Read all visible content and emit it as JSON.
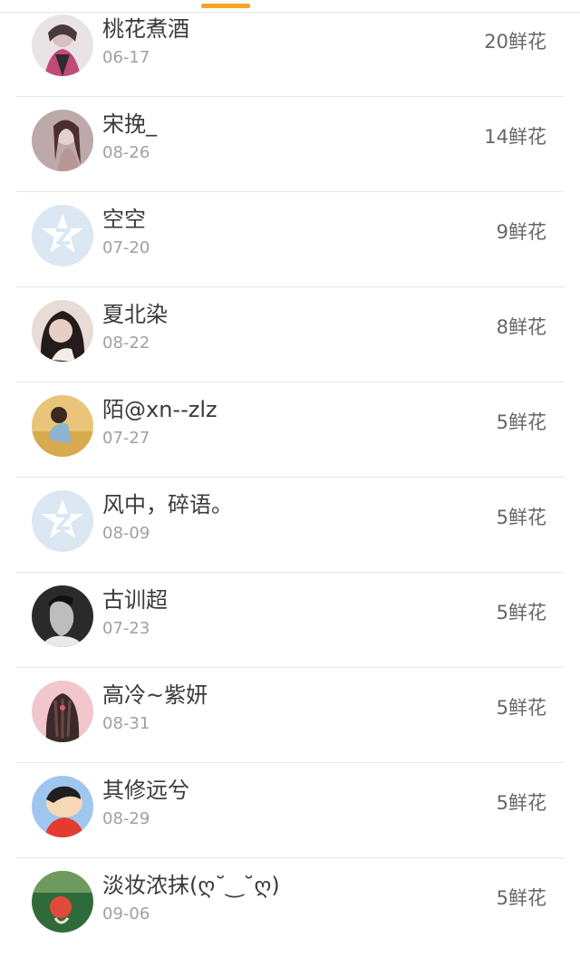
{
  "tab_indicator_color": "#f5a623",
  "rows": [
    {
      "name": "桃花煮酒",
      "date": "06-17",
      "flowers": "20鲜花",
      "avatar": "user-avatar"
    },
    {
      "name": "宋挽_",
      "date": "08-26",
      "flowers": "14鲜花",
      "avatar": "user-avatar"
    },
    {
      "name": "空空",
      "date": "07-20",
      "flowers": "9鲜花",
      "avatar": "default-avatar-icon"
    },
    {
      "name": "夏北染",
      "date": "08-22",
      "flowers": "8鲜花",
      "avatar": "user-avatar"
    },
    {
      "name": "陌@xn--zlz",
      "date": "07-27",
      "flowers": "5鲜花",
      "avatar": "user-avatar"
    },
    {
      "name": "风中，碎语。",
      "date": "08-09",
      "flowers": "5鲜花",
      "avatar": "default-avatar-icon"
    },
    {
      "name": "古训超",
      "date": "07-23",
      "flowers": "5鲜花",
      "avatar": "user-avatar"
    },
    {
      "name": "高冷~紫妍",
      "date": "08-31",
      "flowers": "5鲜花",
      "avatar": "user-avatar"
    },
    {
      "name": "其修远兮",
      "date": "08-29",
      "flowers": "5鲜花",
      "avatar": "user-avatar"
    },
    {
      "name": "淡妆浓抹(ღ˘‿˘ღ)",
      "date": "09-06",
      "flowers": "5鲜花",
      "avatar": "user-avatar"
    }
  ]
}
